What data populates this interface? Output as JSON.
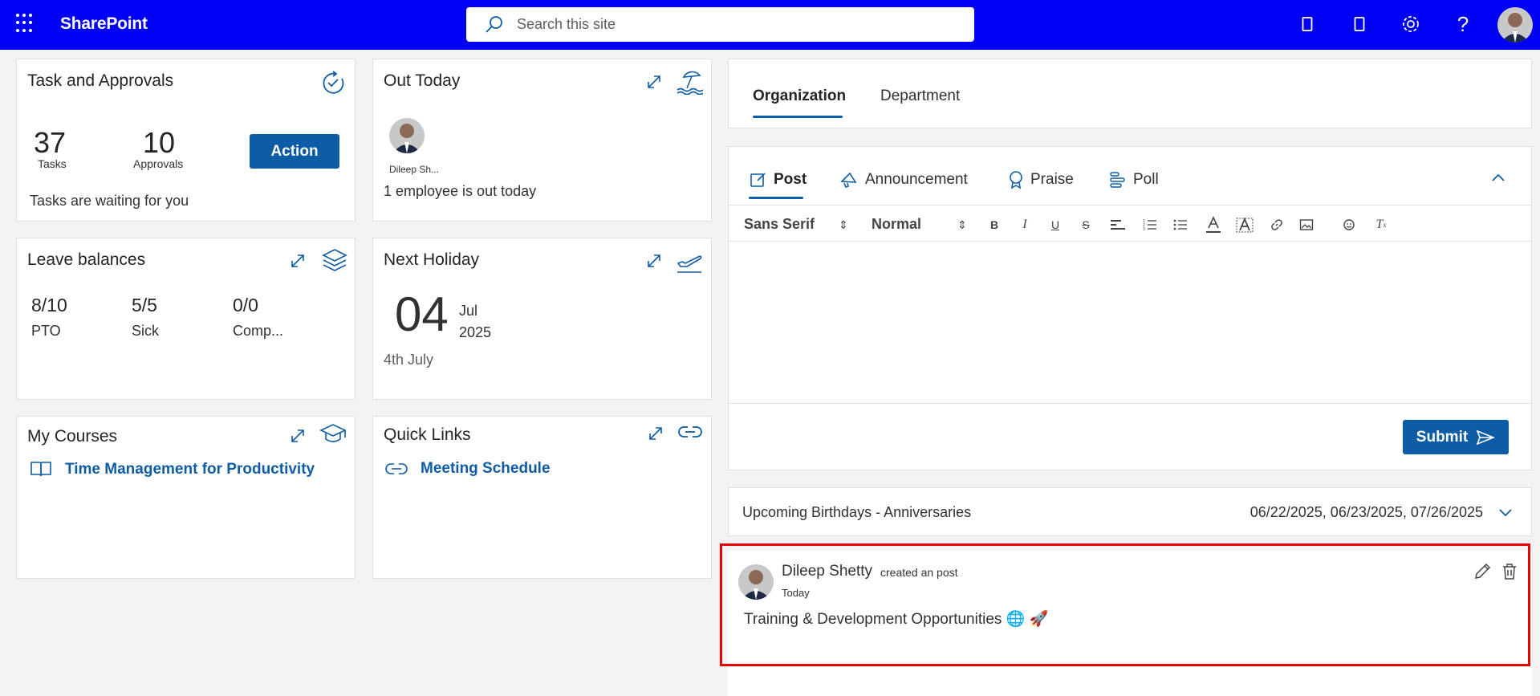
{
  "header": {
    "app_name": "SharePoint",
    "search_placeholder": "Search this site",
    "brand_color": "#0000f5"
  },
  "tasks_card": {
    "title": "Task and Approvals",
    "tasks_count": "37",
    "tasks_label": "Tasks",
    "approvals_count": "10",
    "approvals_label": "Approvals",
    "action_label": "Action",
    "message": "Tasks are waiting for you"
  },
  "out_today": {
    "title": "Out Today",
    "person_name": "Dileep Sh...",
    "message": "1 employee is out today"
  },
  "leave_balances": {
    "title": "Leave balances",
    "items": [
      {
        "value": "8/10",
        "label": "PTO"
      },
      {
        "value": "5/5",
        "label": "Sick"
      },
      {
        "value": "0/0",
        "label": "Comp..."
      }
    ]
  },
  "next_holiday": {
    "title": "Next Holiday",
    "day": "04",
    "month": "Jul",
    "year": "2025",
    "name": "4th July"
  },
  "my_courses": {
    "title": "My Courses",
    "course": "Time Management for Productivity"
  },
  "quick_links": {
    "title": "Quick Links",
    "link": "Meeting Schedule"
  },
  "feed_tabs": {
    "tabs": [
      "Organization",
      "Department"
    ]
  },
  "composer": {
    "types": [
      "Post",
      "Announcement",
      "Praise",
      "Poll"
    ],
    "font_select": "Sans Serif",
    "size_select": "Normal",
    "submit_label": "Submit"
  },
  "birthdays": {
    "label": "Upcoming Birthdays - Anniversaries",
    "dates": "06/22/2025, 06/23/2025, 07/26/2025"
  },
  "post": {
    "author": "Dileep Shetty",
    "action": "created an post",
    "time": "Today",
    "text": "Training & Development Opportunities 🌐 🚀"
  }
}
